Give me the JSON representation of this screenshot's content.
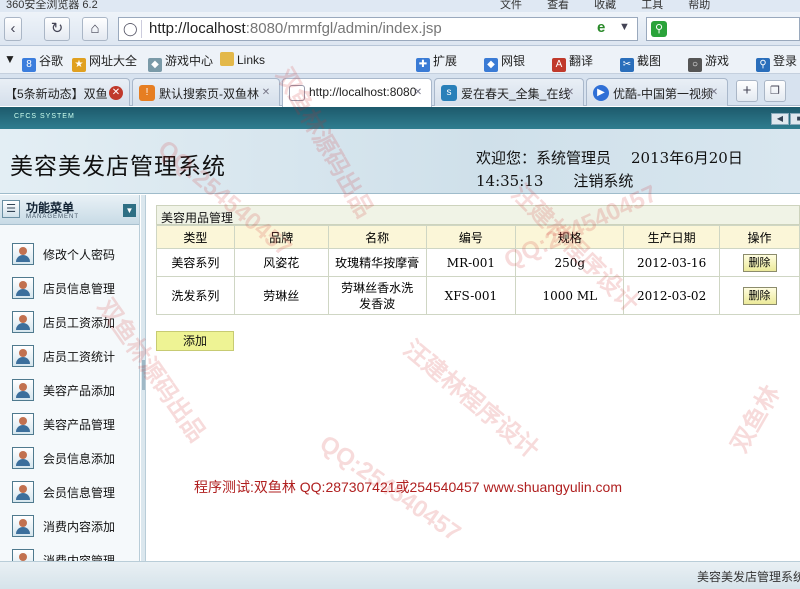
{
  "browser": {
    "title": "360安全浏览器 6.2",
    "menus": [
      "文件",
      "查看",
      "收藏",
      "工具",
      "帮助"
    ],
    "url_host": "http://localhost",
    "url_rest": ":8080/mrmfgl/admin/index.jsp",
    "search_icon": "G-search-icon",
    "bookmarks": [
      {
        "label": "谷歌",
        "icon": "google-icon",
        "color": "#3b7ddd"
      },
      {
        "label": "网址大全",
        "icon": "star-icon",
        "color": "#e0a020"
      },
      {
        "label": "游戏中心",
        "icon": "game-icon",
        "color": "#7a9aa8"
      },
      {
        "label": "Links",
        "icon": "folder-icon",
        "color": "#e3b84a"
      },
      {
        "label": "扩展",
        "icon": "puzzle-icon",
        "color": "#3a7bd5"
      },
      {
        "label": "网银",
        "icon": "bank-icon",
        "color": "#3a7bd5"
      },
      {
        "label": "翻译",
        "icon": "translate-icon",
        "color": "#c0392b"
      },
      {
        "label": "截图",
        "icon": "scissors-icon",
        "color": "#2a6ebb"
      },
      {
        "label": "游戏",
        "icon": "controller-icon",
        "color": "#555"
      },
      {
        "label": "登录",
        "icon": "key-icon",
        "color": "#2a6ebb"
      }
    ],
    "tabs": [
      {
        "label": "【5条新动态】双鱼",
        "color": "#d35400",
        "icon": "weibo-icon"
      },
      {
        "label": "默认搜索页-双鱼林",
        "color": "#e67e22",
        "icon": "search-page-icon"
      },
      {
        "label": "http://localhost:8080",
        "color": "#ffffff",
        "icon": "page-icon"
      },
      {
        "label": "爱在春天_全集_在线",
        "color": "#2980b9",
        "icon": "sohu-icon"
      },
      {
        "label": "优酷-中国第一视频",
        "color": "#2f6fd6",
        "icon": "youku-icon"
      }
    ]
  },
  "app": {
    "strip_label": "CFCS SYSTEM",
    "system_title": "美容美发店管理系统",
    "welcome": "欢迎您：系统管理员",
    "date": "2013年6月20日",
    "time": "14:35:13",
    "logout": "注销系统",
    "sidebar": {
      "title": "功能菜单",
      "subtitle": "MANAGEMENT",
      "items": [
        {
          "label": "修改个人密码"
        },
        {
          "label": "店员信息管理"
        },
        {
          "label": "店员工资添加"
        },
        {
          "label": "店员工资统计"
        },
        {
          "label": "美容产品添加"
        },
        {
          "label": "美容产品管理"
        },
        {
          "label": "会员信息添加"
        },
        {
          "label": "会员信息管理"
        },
        {
          "label": "消费内容添加"
        },
        {
          "label": "消费内容管理"
        }
      ]
    },
    "panel_title": "美容用品管理",
    "table": {
      "headers": [
        "类型",
        "品牌",
        "名称",
        "编号",
        "规格",
        "生产日期",
        "操作"
      ],
      "rows": [
        {
          "type": "美容系列",
          "brand": "风姿花",
          "name": "玫瑰精华按摩膏",
          "code": "MR-001",
          "spec": "250g",
          "date": "2012-03-16",
          "action": "删除"
        },
        {
          "type": "洗发系列",
          "brand": "劳琳丝",
          "name": "劳琳丝香水洗发香波",
          "code": "XFS-001",
          "spec": "1000 ML",
          "date": "2012-03-02",
          "action": "删除"
        }
      ]
    },
    "add_label": "添加",
    "credit": "程序测试:双鱼林 QQ:287307421或254540457 www.shuangyulin.com",
    "footer": "美容美发店管理系统"
  },
  "watermarks": [
    "QQ:254540457",
    "汪建林程序设计",
    "双鱼林源码出品",
    "QQ:254540457",
    "汪建林程序设计",
    "双鱼林源码出品",
    "QQ:254540457",
    "双鱼林"
  ]
}
